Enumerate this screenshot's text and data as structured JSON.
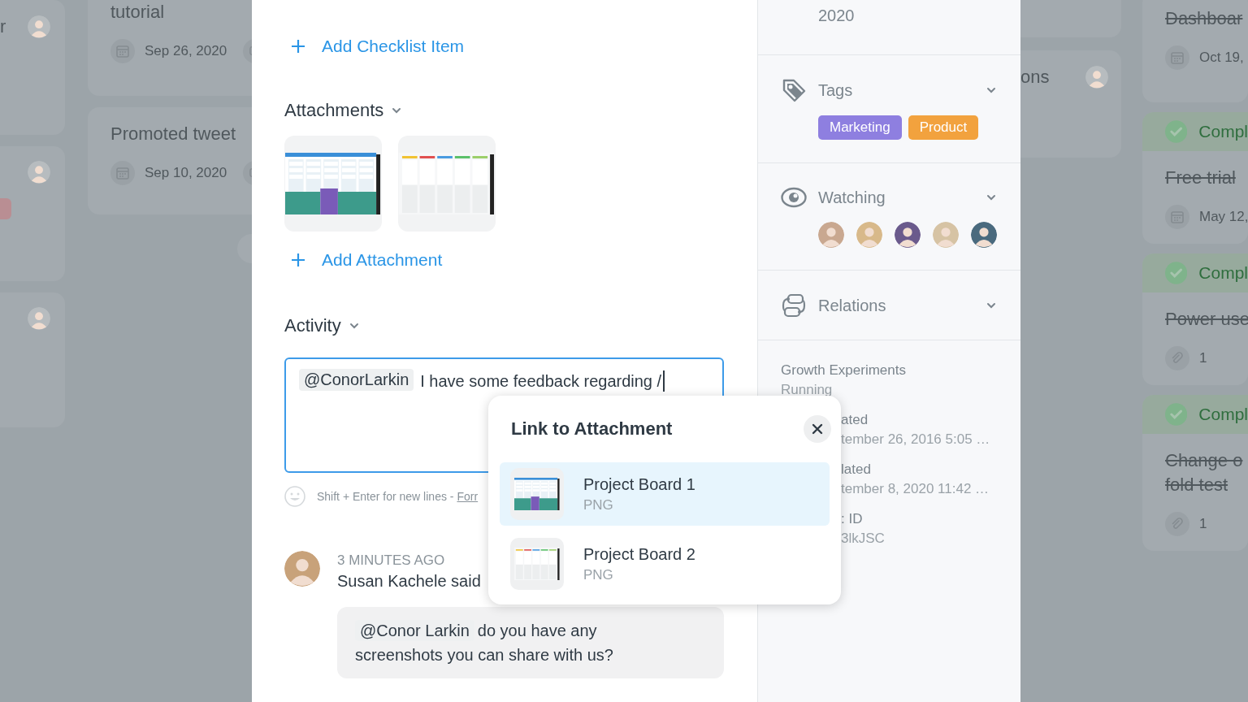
{
  "board": {
    "left_columns": [
      {
        "cards": [
          {
            "title_lines": [
              "r"
            ],
            "avatar": true
          },
          {
            "avatar": true,
            "tag": {
              "color": "#b98e93"
            }
          },
          {
            "avatar": true
          }
        ]
      },
      {
        "cards": [
          {
            "title_lines": [
              "tutorial"
            ],
            "meta": {
              "kind": "date",
              "text": "Sep 26, 2020"
            },
            "comment_icon": true
          },
          {
            "title_lines": [
              "Promoted tweet"
            ],
            "meta": {
              "kind": "date",
              "text": "Sep 10, 2020"
            },
            "comment_icon": true
          }
        ],
        "add_button": true
      }
    ],
    "right_columns": [
      {
        "cards": [
          {
            "kind": "blank"
          },
          {
            "kind": "task",
            "title_lines": [
              "ons"
            ],
            "avatar": true
          }
        ]
      },
      {
        "cards": [
          {
            "title_lines": [
              "Dashboar"
            ],
            "done": true,
            "meta": {
              "kind": "date",
              "text": "Oct 19,"
            }
          },
          {
            "status": "Compl",
            "title_lines": [
              "Free trial"
            ],
            "done": true,
            "meta": {
              "kind": "date",
              "text": "May 12,"
            }
          },
          {
            "status": "Compl",
            "title_lines": [
              "Power use"
            ],
            "done": true,
            "meta": {
              "kind": "attachments",
              "text": "1"
            }
          },
          {
            "status": "Compl",
            "title_lines": [
              "Change o",
              "fold test"
            ],
            "done": true,
            "meta": {
              "kind": "attachments",
              "text": "1"
            }
          }
        ]
      }
    ]
  },
  "main": {
    "add_checklist": "Add Checklist Item",
    "attachments_title": "Attachments",
    "attachments": [
      {
        "kind": "colored-board"
      },
      {
        "kind": "light-board"
      }
    ],
    "add_attachment": "Add Attachment",
    "activity_title": "Activity",
    "comment_box": {
      "mention": "@ConorLarkin",
      "text": "I have some feedback regarding /",
      "focused": true
    },
    "hint": {
      "text": "Shift + Enter for new lines -",
      "link": "Forr"
    },
    "comments": [
      {
        "time": "3 MINUTES AGO",
        "author": "Susan Kachele",
        "verb": "said",
        "mention": "@Conor Larkin",
        "text": "do you have any screenshots you can share with us?"
      }
    ]
  },
  "sidebar": {
    "date_tail": "2020",
    "sections": [
      {
        "kind": "tags",
        "title": "Tags",
        "expanded": false,
        "tags": [
          {
            "label": "Marketing",
            "color": "#8e7fe0"
          },
          {
            "label": "Product",
            "color": "#f2a23e"
          }
        ]
      },
      {
        "kind": "watching",
        "title": "Watching",
        "expanded": false,
        "watchers": [
          {
            "color": "#c9a890"
          },
          {
            "color": "#d8b98a"
          },
          {
            "color": "#6a5a8c"
          },
          {
            "color": "#d6c3a4"
          },
          {
            "color": "#4a6a7e"
          }
        ]
      },
      {
        "kind": "relations",
        "title": "Relations",
        "expanded": false
      }
    ],
    "details": [
      {
        "label": "Growth Experiments",
        "value": "Running",
        "partly_hidden": false
      },
      {
        "label": "ated",
        "value": "tember 26, 2016 5:05 …",
        "partly_hidden": true
      },
      {
        "label": "lated",
        "value": "tember 8, 2020 11:42 …",
        "partly_hidden": true
      },
      {
        "label": ": ID",
        "value": "3lkJSC",
        "partly_hidden": true
      }
    ]
  },
  "popup": {
    "title": "Link to Attachment",
    "items": [
      {
        "name": "Project Board 1",
        "type": "PNG",
        "kind": "colored-board",
        "selected": true
      },
      {
        "name": "Project Board 2",
        "type": "PNG",
        "kind": "light-board",
        "selected": false
      }
    ]
  }
}
